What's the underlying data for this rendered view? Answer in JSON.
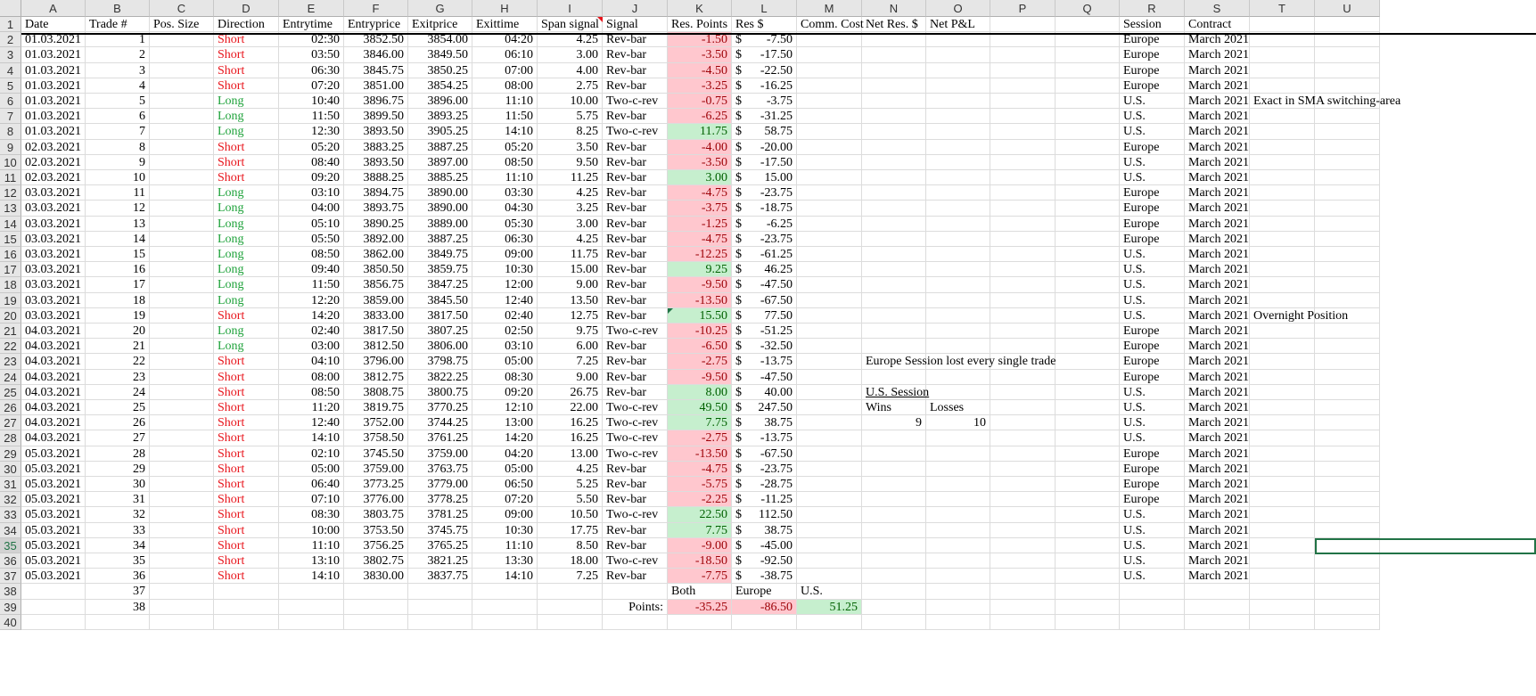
{
  "columns": [
    "A",
    "B",
    "C",
    "D",
    "E",
    "F",
    "G",
    "H",
    "I",
    "J",
    "K",
    "L",
    "M",
    "N",
    "O",
    "P",
    "Q",
    "R",
    "S",
    "T",
    "U"
  ],
  "headers": {
    "A": "Date",
    "B": "Trade #",
    "C": "Pos. Size",
    "D": "Direction",
    "E": "Entrytime",
    "F": "Entryprice",
    "G": "Exitprice",
    "H": "Exittime",
    "I": "Span signal",
    "J": "Signal",
    "K": "Res. Points",
    "L": "Res $",
    "M": "Comm. Cost",
    "N": "Net Res. $",
    "O": "Net P&L",
    "R": "Session",
    "S": "Contract"
  },
  "currency_symbol": "$",
  "trades": [
    {
      "date": "01.03.2021",
      "n": "1",
      "dir": "Short",
      "et": "02:30",
      "ep": "3852.50",
      "xp": "3854.00",
      "xt": "04:20",
      "span": "4.25",
      "sig": "Rev-bar",
      "pts": "-1.50",
      "res": "-7.50",
      "sess": "Europe",
      "con": "March 2021"
    },
    {
      "date": "01.03.2021",
      "n": "2",
      "dir": "Short",
      "et": "03:50",
      "ep": "3846.00",
      "xp": "3849.50",
      "xt": "06:10",
      "span": "3.00",
      "sig": "Rev-bar",
      "pts": "-3.50",
      "res": "-17.50",
      "sess": "Europe",
      "con": "March 2021"
    },
    {
      "date": "01.03.2021",
      "n": "3",
      "dir": "Short",
      "et": "06:30",
      "ep": "3845.75",
      "xp": "3850.25",
      "xt": "07:00",
      "span": "4.00",
      "sig": "Rev-bar",
      "pts": "-4.50",
      "res": "-22.50",
      "sess": "Europe",
      "con": "March 2021"
    },
    {
      "date": "01.03.2021",
      "n": "4",
      "dir": "Short",
      "et": "07:20",
      "ep": "3851.00",
      "xp": "3854.25",
      "xt": "08:00",
      "span": "2.75",
      "sig": "Rev-bar",
      "pts": "-3.25",
      "res": "-16.25",
      "sess": "Europe",
      "con": "March 2021"
    },
    {
      "date": "01.03.2021",
      "n": "5",
      "dir": "Long",
      "et": "10:40",
      "ep": "3896.75",
      "xp": "3896.00",
      "xt": "11:10",
      "span": "10.00",
      "sig": "Two-c-rev",
      "pts": "-0.75",
      "res": "-3.75",
      "sess": "U.S.",
      "con": "March 2021"
    },
    {
      "date": "01.03.2021",
      "n": "6",
      "dir": "Long",
      "et": "11:50",
      "ep": "3899.50",
      "xp": "3893.25",
      "xt": "11:50",
      "span": "5.75",
      "sig": "Rev-bar",
      "pts": "-6.25",
      "res": "-31.25",
      "sess": "U.S.",
      "con": "March 2021"
    },
    {
      "date": "01.03.2021",
      "n": "7",
      "dir": "Long",
      "et": "12:30",
      "ep": "3893.50",
      "xp": "3905.25",
      "xt": "14:10",
      "span": "8.25",
      "sig": "Two-c-rev",
      "pts": "11.75",
      "res": "58.75",
      "sess": "U.S.",
      "con": "March 2021"
    },
    {
      "date": "02.03.2021",
      "n": "8",
      "dir": "Short",
      "et": "05:20",
      "ep": "3883.25",
      "xp": "3887.25",
      "xt": "05:20",
      "span": "3.50",
      "sig": "Rev-bar",
      "pts": "-4.00",
      "res": "-20.00",
      "sess": "Europe",
      "con": "March 2021"
    },
    {
      "date": "02.03.2021",
      "n": "9",
      "dir": "Short",
      "et": "08:40",
      "ep": "3893.50",
      "xp": "3897.00",
      "xt": "08:50",
      "span": "9.50",
      "sig": "Rev-bar",
      "pts": "-3.50",
      "res": "-17.50",
      "sess": "U.S.",
      "con": "March 2021"
    },
    {
      "date": "02.03.2021",
      "n": "10",
      "dir": "Short",
      "et": "09:20",
      "ep": "3888.25",
      "xp": "3885.25",
      "xt": "11:10",
      "span": "11.25",
      "sig": "Rev-bar",
      "pts": "3.00",
      "res": "15.00",
      "sess": "U.S.",
      "con": "March 2021"
    },
    {
      "date": "03.03.2021",
      "n": "11",
      "dir": "Long",
      "et": "03:10",
      "ep": "3894.75",
      "xp": "3890.00",
      "xt": "03:30",
      "span": "4.25",
      "sig": "Rev-bar",
      "pts": "-4.75",
      "res": "-23.75",
      "sess": "Europe",
      "con": "March 2021"
    },
    {
      "date": "03.03.2021",
      "n": "12",
      "dir": "Long",
      "et": "04:00",
      "ep": "3893.75",
      "xp": "3890.00",
      "xt": "04:30",
      "span": "3.25",
      "sig": "Rev-bar",
      "pts": "-3.75",
      "res": "-18.75",
      "sess": "Europe",
      "con": "March 2021"
    },
    {
      "date": "03.03.2021",
      "n": "13",
      "dir": "Long",
      "et": "05:10",
      "ep": "3890.25",
      "xp": "3889.00",
      "xt": "05:30",
      "span": "3.00",
      "sig": "Rev-bar",
      "pts": "-1.25",
      "res": "-6.25",
      "sess": "Europe",
      "con": "March 2021"
    },
    {
      "date": "03.03.2021",
      "n": "14",
      "dir": "Long",
      "et": "05:50",
      "ep": "3892.00",
      "xp": "3887.25",
      "xt": "06:30",
      "span": "4.25",
      "sig": "Rev-bar",
      "pts": "-4.75",
      "res": "-23.75",
      "sess": "Europe",
      "con": "March 2021"
    },
    {
      "date": "03.03.2021",
      "n": "15",
      "dir": "Long",
      "et": "08:50",
      "ep": "3862.00",
      "xp": "3849.75",
      "xt": "09:00",
      "span": "11.75",
      "sig": "Rev-bar",
      "pts": "-12.25",
      "res": "-61.25",
      "sess": "U.S.",
      "con": "March 2021"
    },
    {
      "date": "03.03.2021",
      "n": "16",
      "dir": "Long",
      "et": "09:40",
      "ep": "3850.50",
      "xp": "3859.75",
      "xt": "10:30",
      "span": "15.00",
      "sig": "Rev-bar",
      "pts": "9.25",
      "res": "46.25",
      "sess": "U.S.",
      "con": "March 2021"
    },
    {
      "date": "03.03.2021",
      "n": "17",
      "dir": "Long",
      "et": "11:50",
      "ep": "3856.75",
      "xp": "3847.25",
      "xt": "12:00",
      "span": "9.00",
      "sig": "Rev-bar",
      "pts": "-9.50",
      "res": "-47.50",
      "sess": "U.S.",
      "con": "March 2021"
    },
    {
      "date": "03.03.2021",
      "n": "18",
      "dir": "Long",
      "et": "12:20",
      "ep": "3859.00",
      "xp": "3845.50",
      "xt": "12:40",
      "span": "13.50",
      "sig": "Rev-bar",
      "pts": "-13.50",
      "res": "-67.50",
      "sess": "U.S.",
      "con": "March 2021"
    },
    {
      "date": "03.03.2021",
      "n": "19",
      "dir": "Short",
      "et": "14:20",
      "ep": "3833.00",
      "xp": "3817.50",
      "xt": "02:40",
      "span": "12.75",
      "sig": "Rev-bar",
      "pts": "15.50",
      "res": "77.50",
      "sess": "U.S.",
      "con": "March 2021"
    },
    {
      "date": "04.03.2021",
      "n": "20",
      "dir": "Long",
      "et": "02:40",
      "ep": "3817.50",
      "xp": "3807.25",
      "xt": "02:50",
      "span": "9.75",
      "sig": "Two-c-rev",
      "pts": "-10.25",
      "res": "-51.25",
      "sess": "Europe",
      "con": "March 2021"
    },
    {
      "date": "04.03.2021",
      "n": "21",
      "dir": "Long",
      "et": "03:00",
      "ep": "3812.50",
      "xp": "3806.00",
      "xt": "03:10",
      "span": "6.00",
      "sig": "Rev-bar",
      "pts": "-6.50",
      "res": "-32.50",
      "sess": "Europe",
      "con": "March 2021"
    },
    {
      "date": "04.03.2021",
      "n": "22",
      "dir": "Short",
      "et": "04:10",
      "ep": "3796.00",
      "xp": "3798.75",
      "xt": "05:00",
      "span": "7.25",
      "sig": "Rev-bar",
      "pts": "-2.75",
      "res": "-13.75",
      "sess": "Europe",
      "con": "March 2021"
    },
    {
      "date": "04.03.2021",
      "n": "23",
      "dir": "Short",
      "et": "08:00",
      "ep": "3812.75",
      "xp": "3822.25",
      "xt": "08:30",
      "span": "9.00",
      "sig": "Rev-bar",
      "pts": "-9.50",
      "res": "-47.50",
      "sess": "Europe",
      "con": "March 2021"
    },
    {
      "date": "04.03.2021",
      "n": "24",
      "dir": "Short",
      "et": "08:50",
      "ep": "3808.75",
      "xp": "3800.75",
      "xt": "09:20",
      "span": "26.75",
      "sig": "Rev-bar",
      "pts": "8.00",
      "res": "40.00",
      "sess": "U.S.",
      "con": "March 2021"
    },
    {
      "date": "04.03.2021",
      "n": "25",
      "dir": "Short",
      "et": "11:20",
      "ep": "3819.75",
      "xp": "3770.25",
      "xt": "12:10",
      "span": "22.00",
      "sig": "Two-c-rev",
      "pts": "49.50",
      "res": "247.50",
      "sess": "U.S.",
      "con": "March 2021"
    },
    {
      "date": "04.03.2021",
      "n": "26",
      "dir": "Short",
      "et": "12:40",
      "ep": "3752.00",
      "xp": "3744.25",
      "xt": "13:00",
      "span": "16.25",
      "sig": "Two-c-rev",
      "pts": "7.75",
      "res": "38.75",
      "sess": "U.S.",
      "con": "March 2021"
    },
    {
      "date": "04.03.2021",
      "n": "27",
      "dir": "Short",
      "et": "14:10",
      "ep": "3758.50",
      "xp": "3761.25",
      "xt": "14:20",
      "span": "16.25",
      "sig": "Two-c-rev",
      "pts": "-2.75",
      "res": "-13.75",
      "sess": "U.S.",
      "con": "March 2021"
    },
    {
      "date": "05.03.2021",
      "n": "28",
      "dir": "Short",
      "et": "02:10",
      "ep": "3745.50",
      "xp": "3759.00",
      "xt": "04:20",
      "span": "13.00",
      "sig": "Two-c-rev",
      "pts": "-13.50",
      "res": "-67.50",
      "sess": "Europe",
      "con": "March 2021"
    },
    {
      "date": "05.03.2021",
      "n": "29",
      "dir": "Short",
      "et": "05:00",
      "ep": "3759.00",
      "xp": "3763.75",
      "xt": "05:00",
      "span": "4.25",
      "sig": "Rev-bar",
      "pts": "-4.75",
      "res": "-23.75",
      "sess": "Europe",
      "con": "March 2021"
    },
    {
      "date": "05.03.2021",
      "n": "30",
      "dir": "Short",
      "et": "06:40",
      "ep": "3773.25",
      "xp": "3779.00",
      "xt": "06:50",
      "span": "5.25",
      "sig": "Rev-bar",
      "pts": "-5.75",
      "res": "-28.75",
      "sess": "Europe",
      "con": "March 2021"
    },
    {
      "date": "05.03.2021",
      "n": "31",
      "dir": "Short",
      "et": "07:10",
      "ep": "3776.00",
      "xp": "3778.25",
      "xt": "07:20",
      "span": "5.50",
      "sig": "Rev-bar",
      "pts": "-2.25",
      "res": "-11.25",
      "sess": "Europe",
      "con": "March 2021"
    },
    {
      "date": "05.03.2021",
      "n": "32",
      "dir": "Short",
      "et": "08:30",
      "ep": "3803.75",
      "xp": "3781.25",
      "xt": "09:00",
      "span": "10.50",
      "sig": "Two-c-rev",
      "pts": "22.50",
      "res": "112.50",
      "sess": "U.S.",
      "con": "March 2021"
    },
    {
      "date": "05.03.2021",
      "n": "33",
      "dir": "Short",
      "et": "10:00",
      "ep": "3753.50",
      "xp": "3745.75",
      "xt": "10:30",
      "span": "17.75",
      "sig": "Rev-bar",
      "pts": "7.75",
      "res": "38.75",
      "sess": "U.S.",
      "con": "March 2021"
    },
    {
      "date": "05.03.2021",
      "n": "34",
      "dir": "Short",
      "et": "11:10",
      "ep": "3756.25",
      "xp": "3765.25",
      "xt": "11:10",
      "span": "8.50",
      "sig": "Rev-bar",
      "pts": "-9.00",
      "res": "-45.00",
      "sess": "U.S.",
      "con": "March 2021"
    },
    {
      "date": "05.03.2021",
      "n": "35",
      "dir": "Short",
      "et": "13:10",
      "ep": "3802.75",
      "xp": "3821.25",
      "xt": "13:30",
      "span": "18.00",
      "sig": "Two-c-rev",
      "pts": "-18.50",
      "res": "-92.50",
      "sess": "U.S.",
      "con": "March 2021"
    },
    {
      "date": "05.03.2021",
      "n": "36",
      "dir": "Short",
      "et": "14:10",
      "ep": "3830.00",
      "xp": "3837.75",
      "xt": "14:10",
      "span": "7.25",
      "sig": "Rev-bar",
      "pts": "-7.75",
      "res": "-38.75",
      "sess": "U.S.",
      "con": "March 2021"
    }
  ],
  "notes": {
    "row6": "Exact in SMA switching-area",
    "row20": "Overnight Position",
    "row23": "Europe Session lost every single trade",
    "us_session_title": "U.S. Session",
    "wins_label": "Wins",
    "losses_label": "Losses",
    "wins": "9",
    "losses": "10"
  },
  "row38": {
    "trade_n": "37",
    "both": "Both",
    "europe": "Europe",
    "us": "U.S."
  },
  "row39": {
    "trade_n": "38",
    "points_label": "Points:",
    "both": "-35.25",
    "europe": "-86.50",
    "us": "51.25"
  },
  "extra_rows": [
    "40"
  ]
}
